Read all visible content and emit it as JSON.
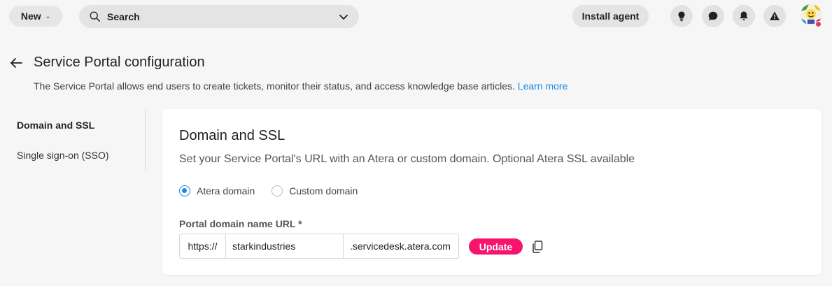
{
  "topbar": {
    "new_label": "New",
    "search_label": "Search",
    "install_label": "Install agent",
    "icons": [
      "lightbulb-icon",
      "chat-icon",
      "bell-icon",
      "warning-icon"
    ]
  },
  "header": {
    "title": "Service Portal configuration",
    "description": "The Service Portal allows end users to create tickets, monitor their status, and access knowledge base articles.",
    "learn_more": "Learn more"
  },
  "sidenav": {
    "items": [
      {
        "label": "Domain and SSL",
        "active": true
      },
      {
        "label": "Single sign-on (SSO)",
        "active": false
      }
    ]
  },
  "card": {
    "title": "Domain and SSL",
    "description": "Set your Service Portal's URL with an Atera or custom domain. Optional Atera SSL available",
    "radio_options": [
      {
        "label": "Atera domain",
        "checked": true
      },
      {
        "label": "Custom domain",
        "checked": false
      }
    ],
    "field_label": "Portal domain name URL *",
    "url_prefix": "https://",
    "url_value": "starkindustries",
    "url_suffix": ".servicedesk.atera.com",
    "update_label": "Update"
  },
  "colors": {
    "accent": "#1e88e5",
    "update_button": "#f5146e",
    "background": "#f6f6f6"
  }
}
